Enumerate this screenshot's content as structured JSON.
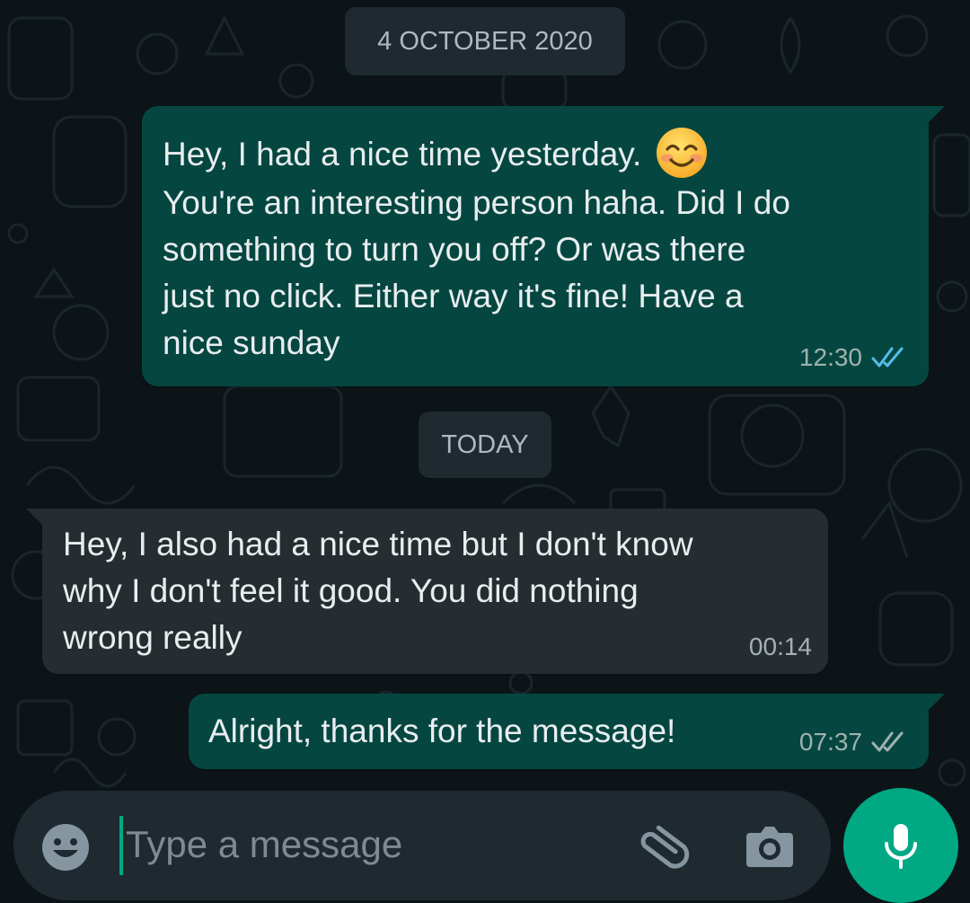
{
  "date_separators": {
    "first": "4 OCTOBER 2020",
    "second": "TODAY"
  },
  "messages": [
    {
      "direction": "outgoing",
      "line1": "Hey, I had a nice time yesterday. ",
      "emoji": "smiling-face-icon",
      "rest": "You're an interesting person haha. Did I do\nsomething to turn you off? Or was there\njust no click. Either way it's fine! Have a\nnice sunday",
      "time": "12:30",
      "status": "read"
    },
    {
      "direction": "incoming",
      "text": "Hey, I also had a nice time but I don't know\nwhy I don't feel it good. You did nothing\nwrong really",
      "time": "00:14"
    },
    {
      "direction": "outgoing",
      "text": "Alright, thanks for the message!",
      "time": "07:37",
      "status": "delivered"
    }
  ],
  "composer": {
    "placeholder": "Type a message",
    "icons": [
      "emoji-icon",
      "attach-icon",
      "camera-icon",
      "mic-icon"
    ]
  },
  "colors": {
    "background": "#0d1418",
    "outgoing_bubble": "#054740",
    "incoming_bubble": "#262d31",
    "accent": "#00a884",
    "read_ticks": "#53bdeb",
    "delivered_ticks": "#9fb2ad"
  }
}
